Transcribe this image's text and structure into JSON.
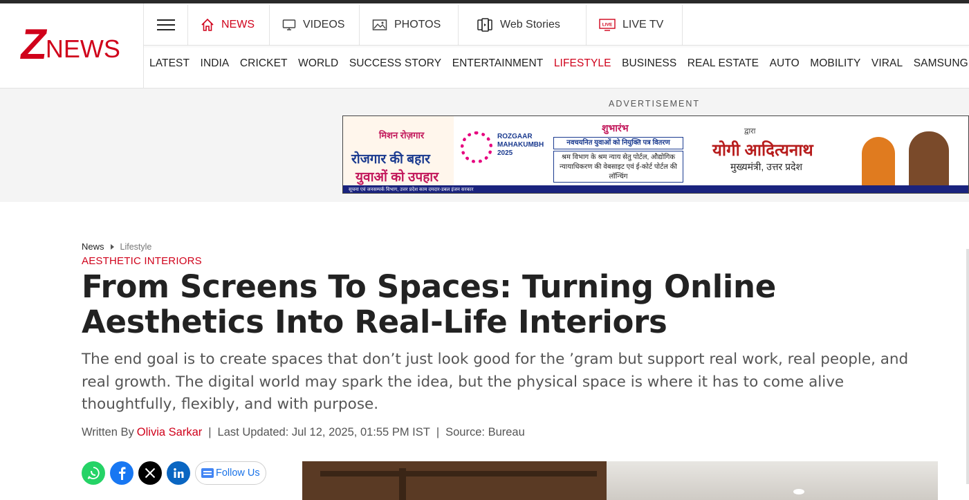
{
  "logo": {
    "z": "Z",
    "news": "NEWS"
  },
  "menu": [
    {
      "label": "NEWS",
      "icon": "home-icon",
      "active": true
    },
    {
      "label": "VIDEOS",
      "icon": "monitor-icon",
      "active": false
    },
    {
      "label": "PHOTOS",
      "icon": "image-icon",
      "active": false
    },
    {
      "label": "Web Stories",
      "icon": "stories-icon",
      "active": false
    },
    {
      "label": "LIVE TV",
      "icon": "live-tv-icon",
      "active": false
    }
  ],
  "live_badge": "LIVE",
  "categories": [
    "LATEST",
    "INDIA",
    "CRICKET",
    "WORLD",
    "SUCCESS STORY",
    "ENTERTAINMENT",
    "LIFESTYLE",
    "BUSINESS",
    "REAL ESTATE",
    "AUTO",
    "MOBILITY",
    "VIRAL",
    "SAMSUNG HEA"
  ],
  "active_category": "LIFESTYLE",
  "ad": {
    "label": "ADVERTISEMENT",
    "left_small": "मिशन रोज़गार",
    "left_big1": "रोजगार की बहार",
    "left_big2": "युवाओं को उपहार",
    "mid_title": "ROZGAAR MAHAKUMBH",
    "mid_year": "2025",
    "center_head": "शुभारंभ",
    "center_box1": "नवचयनित युवाओं को नियुक्ति पत्र वितरण",
    "center_box2": "श्रम विभाग के श्रम न्याय सेतु पोर्टल, औद्योगिक न्यायाधिकरण की वेबसाइट एवं ई-कोर्ट पोर्टल की लॉन्चिंग",
    "right_by": "द्वारा",
    "right_name": "योगी आदित्यनाथ",
    "right_role": "मुख्यमंत्री, उत्तर प्रदेश",
    "strip": "सूचना एवं जनसम्पर्क विभाग, उत्तर प्रदेश     काम दमदार-डबल इंजन सरकार"
  },
  "breadcrumb": {
    "home": "News",
    "current": "Lifestyle"
  },
  "article": {
    "kicker": "AESTHETIC INTERIORS",
    "headline": "From Screens To Spaces: Turning Online Aesthetics Into Real-Life Interiors",
    "summary": "The end goal is to create spaces that don’t just look good for the ’gram but support real work, real people, and real growth. The digital world may spark the idea, but the physical space is where it has to come alive thoughtfully, flexibly, and with purpose.",
    "written_by": "Written By",
    "author": "Olivia Sarkar",
    "updated": "Last Updated: Jul 12, 2025, 01:55 PM IST",
    "source": "Source: Bureau"
  },
  "share": {
    "follow_label": "Follow Us"
  },
  "colors": {
    "brand": "#d0021b",
    "whatsapp": "#25d366",
    "facebook": "#1877f2",
    "x": "#000000",
    "linkedin": "#0a66c2"
  }
}
